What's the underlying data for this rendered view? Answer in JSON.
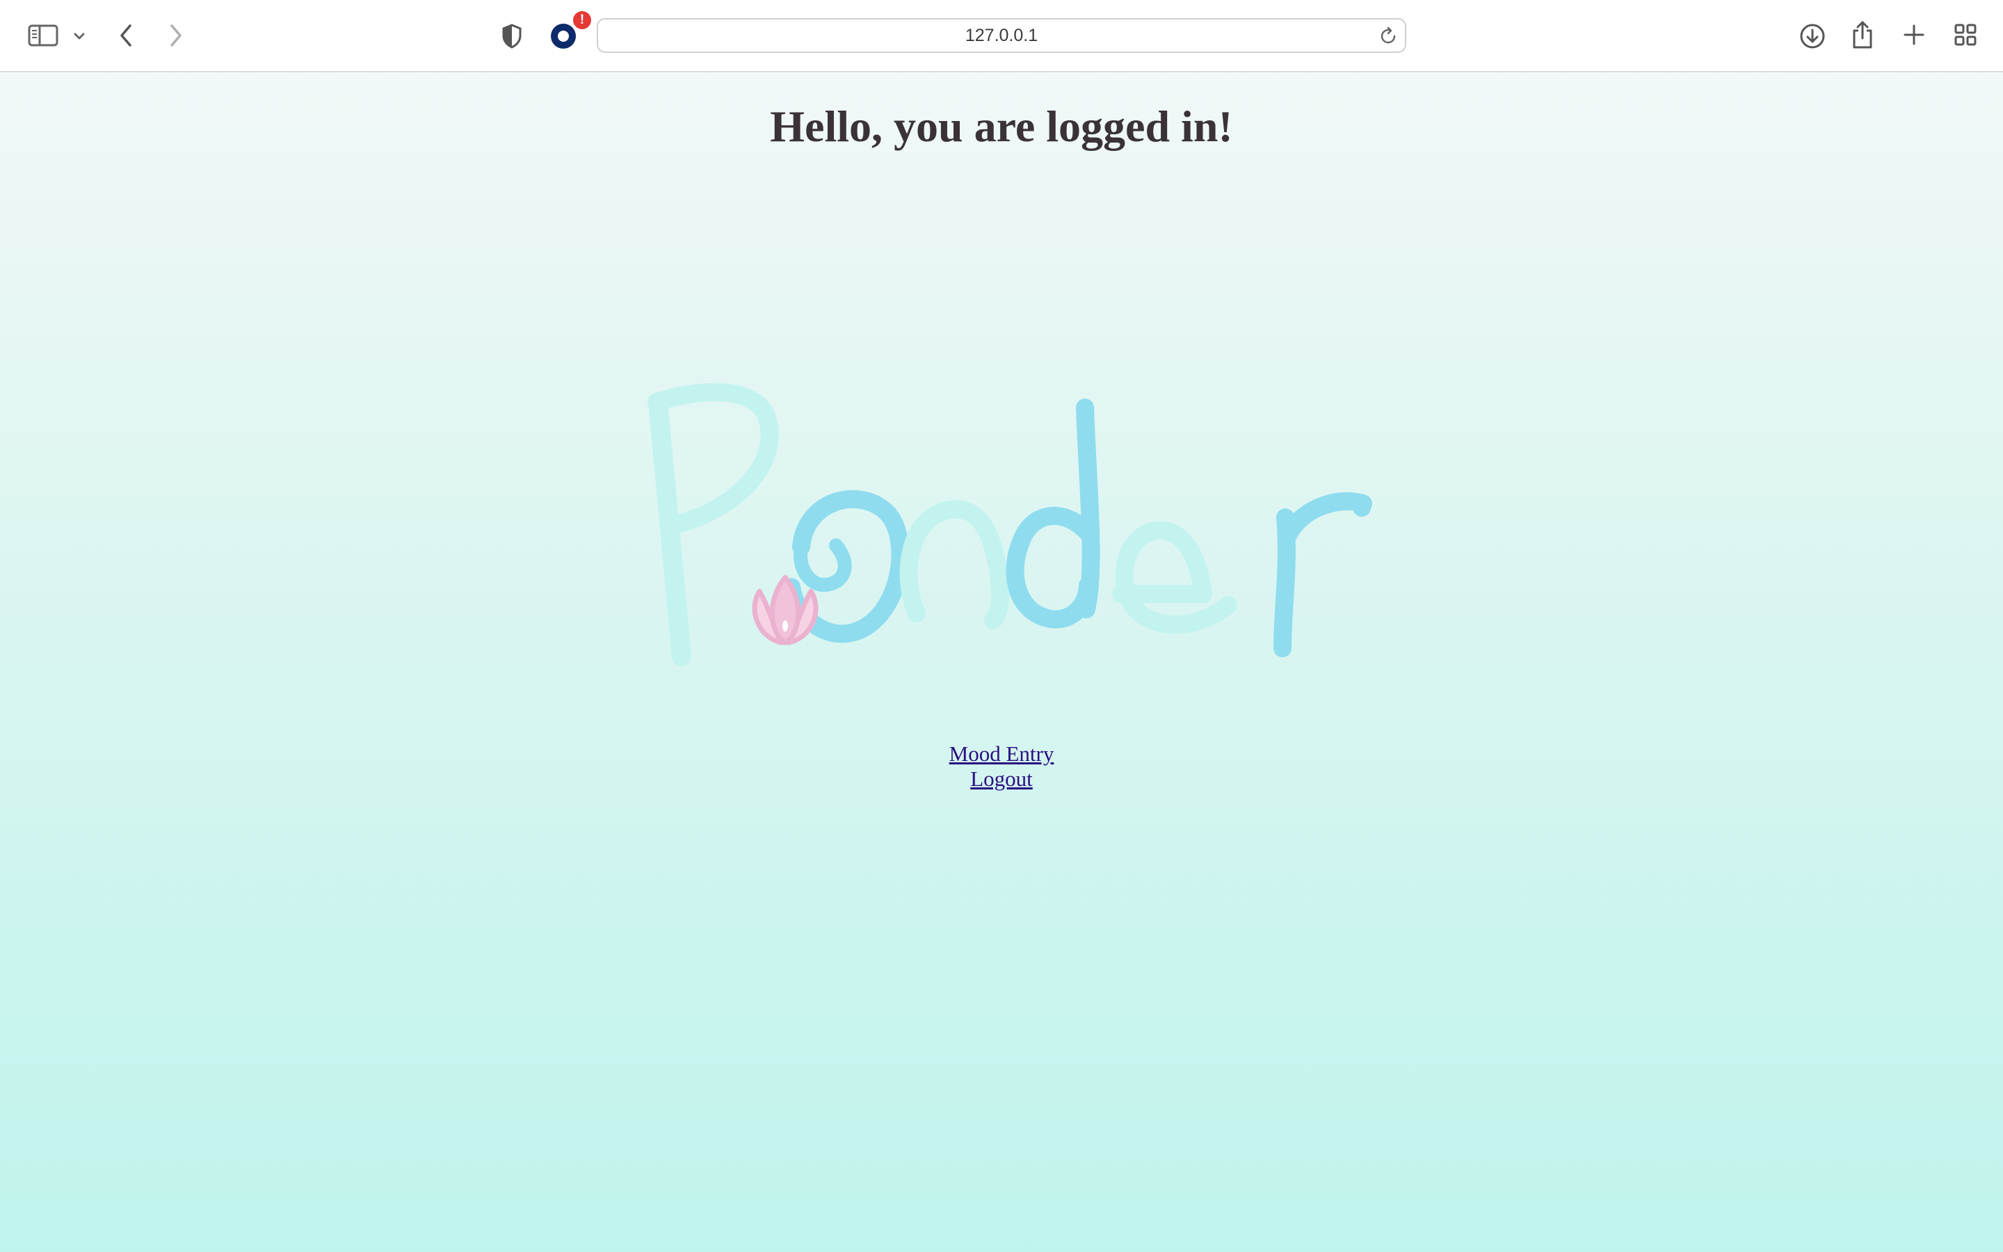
{
  "browser": {
    "url": "127.0.0.1",
    "extension_badge": "!",
    "icons": {
      "sidebar": "sidebar-icon",
      "sidebar_menu": "chevron-down-icon",
      "back": "chevron-left-icon",
      "forward": "chevron-right-icon",
      "privacy": "shield-icon",
      "extension": "ring-extension-icon",
      "reload": "reload-icon",
      "downloads": "download-icon",
      "share": "share-icon",
      "new_tab": "plus-icon",
      "tab_overview": "grid-icon"
    }
  },
  "page": {
    "title": "Hello, you are logged in!",
    "logo_text": "Ponder",
    "links": {
      "mood_entry": "Mood Entry",
      "logout": "Logout"
    }
  },
  "colors": {
    "title": "#3a3238",
    "link": "#2a0e82",
    "logo_blue": "#8fdcef",
    "logo_mint": "#c3f3ee",
    "lotus": "#eab2cf",
    "badge": "#e53935",
    "background_top": "#f1f8f7",
    "background_bottom": "#bff4ec"
  }
}
